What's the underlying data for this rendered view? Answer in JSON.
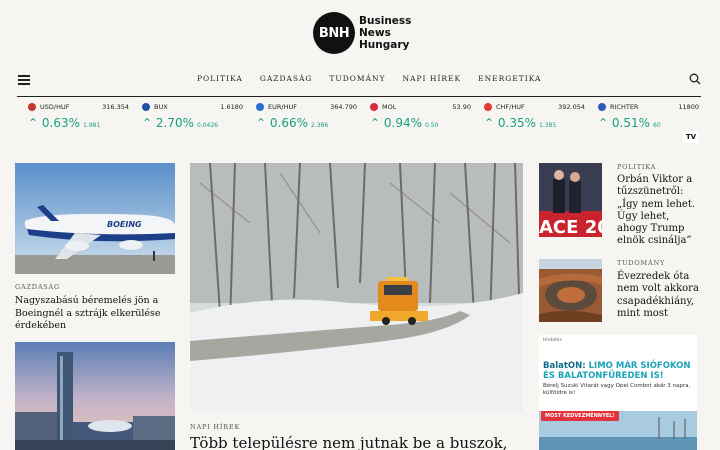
{
  "logo": {
    "mark": "BNH",
    "line1": "Business",
    "line2": "News",
    "line3": "Hungary"
  },
  "nav": {
    "items": [
      "POLITIKA",
      "GAZDASÁG",
      "TUDOMÁNY",
      "NAPI HÍREK",
      "ENERGETIKA"
    ]
  },
  "ticker": [
    {
      "name": "USD/HUF",
      "price": "316.354",
      "pct": "0.63%",
      "delta": "1.981",
      "icon_color": "#c0392b"
    },
    {
      "name": "BUX",
      "price": "1.6180",
      "pct": "2.70%",
      "delta": "0.0426",
      "icon_color": "#1f4fa3"
    },
    {
      "name": "EUR/HUF",
      "price": "364.790",
      "pct": "0.66%",
      "delta": "2.386",
      "icon_color": "#2a6fd6"
    },
    {
      "name": "MOL",
      "price": "53.90",
      "pct": "0.94%",
      "delta": "0.50",
      "icon_color": "#d62d3a"
    },
    {
      "name": "CHF/HUF",
      "price": "392.054",
      "pct": "0.35%",
      "delta": "1.385",
      "icon_color": "#e03b2d"
    },
    {
      "name": "RICHTER",
      "price": "11800",
      "pct": "0.51%",
      "delta": "60",
      "icon_color": "#2b5cb8"
    }
  ],
  "tradingview_badge": "TV",
  "articles": {
    "left1": {
      "category": "GAZDASÁG",
      "title": "Nagyszabású béremelés jön a Boeingnél a sztrájk elkerülése érdekében"
    },
    "center": {
      "category": "NAPI HÍREK",
      "title": "Több településre nem jutnak be a buszok,"
    },
    "right1": {
      "category": "POLITIKA",
      "title": "Orbán Viktor a tűzszünetről: „Így nem lehet. Úgy lehet, ahogy Trump elnök csinálja”"
    },
    "right2": {
      "category": "TUDOMÁNY",
      "title": "Évezredek óta nem volt akkora csapadékhiány, mint most"
    }
  },
  "ad": {
    "label": "Hirdetés",
    "headline_brand": "BalatON:",
    "headline_rest": "LIMO MÁR SIÓFOKON ÉS BALATONFÜREDEN IS!",
    "body": "Bérelj Suzuki Vitarát vagy Opel Combot akár 3 napra, külföldre is!",
    "cta": "MOST KEDVEZMÉNNYEL!"
  },
  "colors": {
    "positive": "#18a085",
    "ad_accent": "#1aa3b8",
    "ad_cta": "#e3333b"
  }
}
